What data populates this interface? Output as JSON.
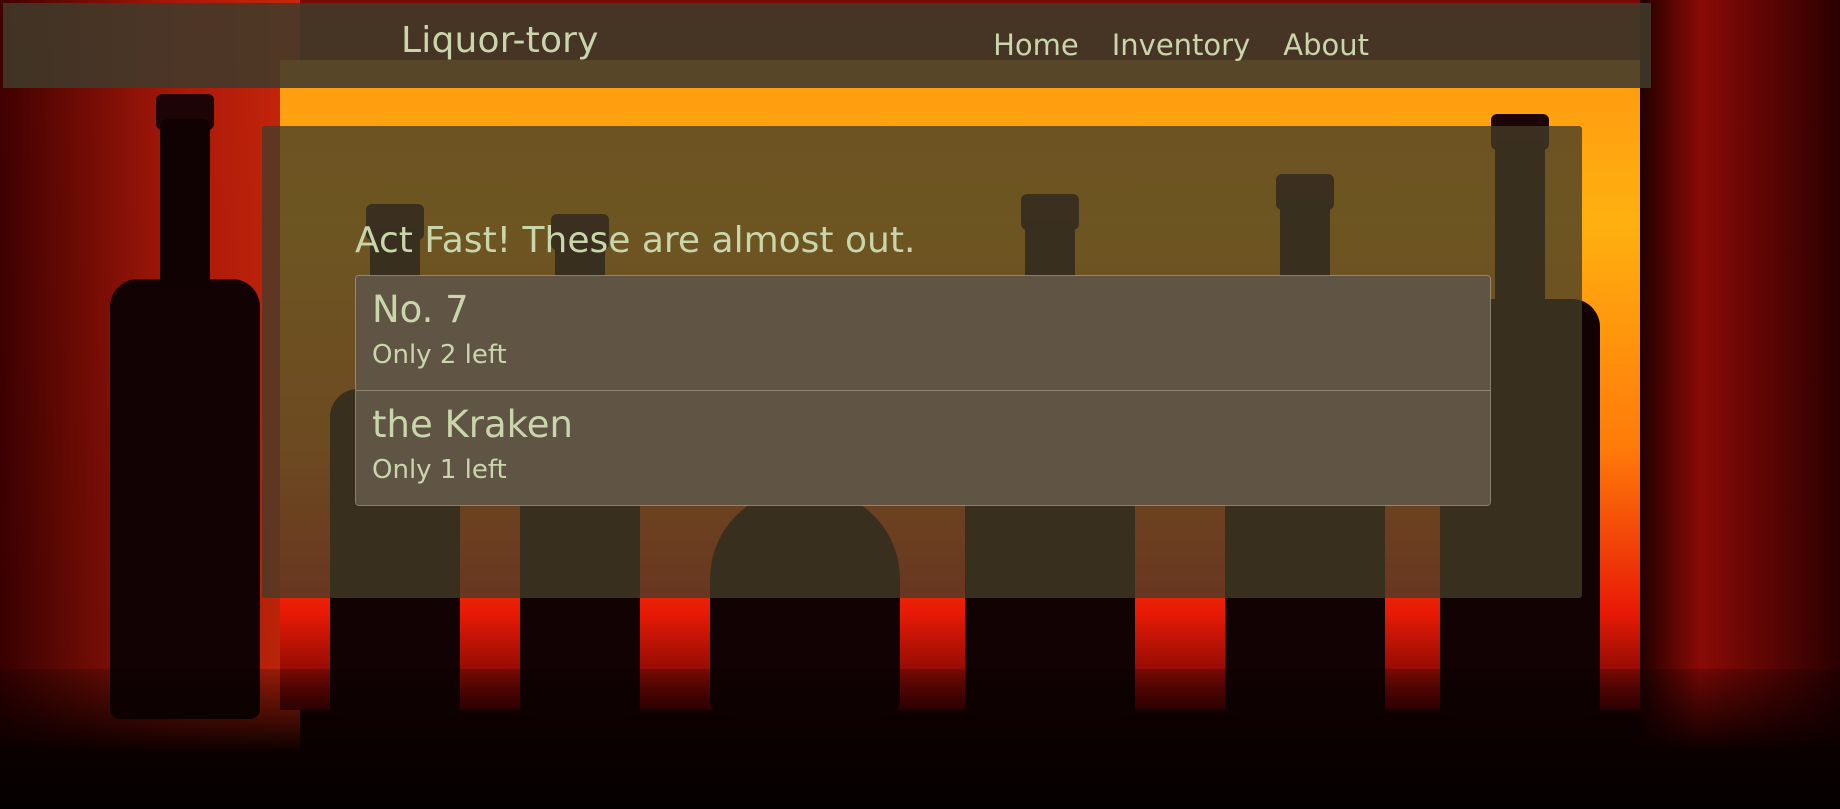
{
  "navbar": {
    "brand": "Liquor-tory",
    "links": [
      "Home",
      "Inventory",
      "About"
    ]
  },
  "main": {
    "heading": "Act Fast! These are almost out.",
    "items": [
      {
        "name": "No. 7",
        "stock": "Only 2 left"
      },
      {
        "name": "the Kraken",
        "stock": "Only 1 left"
      }
    ]
  },
  "colors": {
    "text": "#c9d5aa",
    "navbar_bg": "#403a2a",
    "list_item_bg": "#605444"
  }
}
